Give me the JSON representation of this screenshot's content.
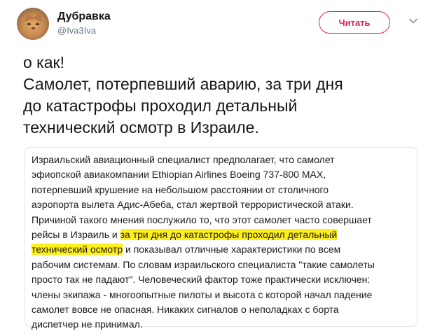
{
  "author": {
    "display_name": "Дубравка",
    "handle": "@Iva3Iva"
  },
  "header": {
    "follow_label": "Читать",
    "menu_icon": "chevron-down-icon",
    "accent_color": "#e0245e"
  },
  "tweet": {
    "text": "о как!\nСамолет, потерпевший аварию, за три дня\nдо катастрофы проходил детальный\nтехнический осмотр в Израиле."
  },
  "quote": {
    "line1": "Израильский авиационный специалист предполагает, что самолет",
    "line2": "эфиопской авиакомпании Ethiopian Airlines Boeing 737-800 MAX,",
    "line3": "потерпевший крушение на небольшом расстоянии от столичного",
    "line4": "аэропорта вылета Адис-Абеба, стал жертвой террористической атаки.",
    "line5": "Причиной такого мнения послужило то, что этот самолет часто совершает",
    "line6_before": "рейсы в Израиль и ",
    "line6_highlight": "за три дня до катастрофы проходил детальный",
    "line7_highlight": "технический осмотр",
    "line7_after": " и показывал отличные характеристики по всем",
    "line8": "рабочим системам. По словам израильского специалиста \"такие самолеты",
    "line9": "просто так не падают\". Человеческий фактор тоже практически исключен:",
    "line10": "члены экипажа - многоопытные пилоты и высота с которой начал падение",
    "line11": "самолет вовсе не опасная. Никаких сигналов о неполадках с борта",
    "line12": "диспетчер не принимал.",
    "highlight_color": "#ffef1a"
  }
}
